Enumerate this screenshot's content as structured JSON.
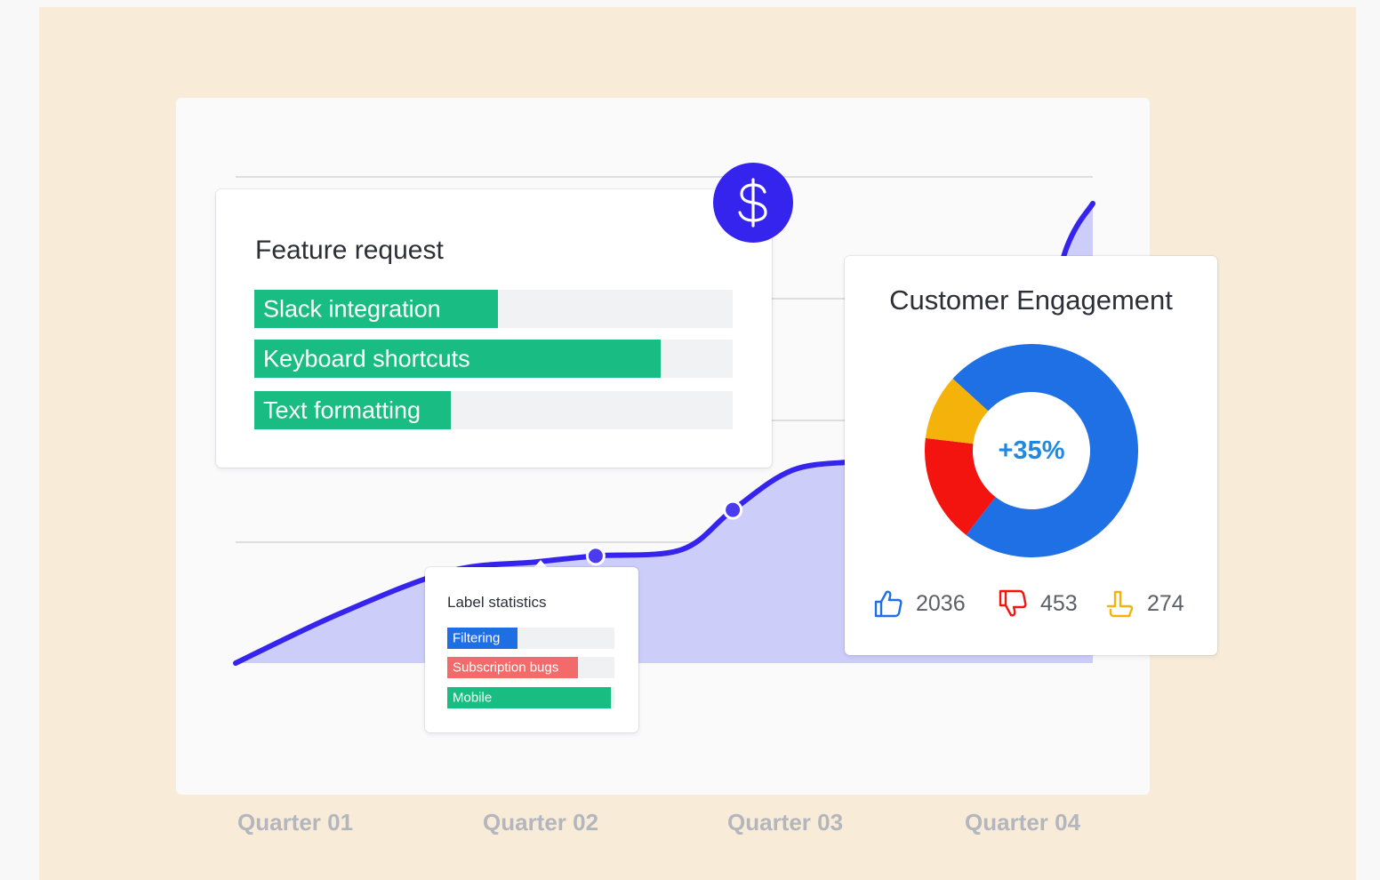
{
  "colors": {
    "background_panel": "#f8ecd9",
    "line": "#3524ee",
    "area": "#cdcdfa",
    "feature_bar": "#19bd84",
    "filtering": "#1e6fe3",
    "subscription_bugs": "#f26a6a",
    "mobile": "#19bd84",
    "donut_blue": "#1f6fe5",
    "donut_red": "#f4140f",
    "donut_yellow": "#f4b20a",
    "center_text": "#1e88e5"
  },
  "chart_data": {
    "type": "area",
    "categories": [
      "Quarter 01",
      "Quarter 02",
      "Quarter 03",
      "Quarter 04"
    ],
    "x": [
      0,
      0.12,
      0.25,
      0.35,
      0.42,
      0.52,
      0.58,
      0.65,
      0.73,
      0.8,
      0.86,
      0.93,
      0.97,
      1.0
    ],
    "y": [
      0,
      16,
      30,
      33,
      35,
      37,
      50,
      63,
      66,
      69,
      72,
      100,
      136,
      150
    ],
    "markers": [
      4,
      6,
      11
    ],
    "ylim": [
      0,
      170
    ],
    "grid": true,
    "gridlines": 4
  },
  "axis": {
    "quarters": [
      "Quarter 01",
      "Quarter 02",
      "Quarter 03",
      "Quarter 04"
    ]
  },
  "feature_request": {
    "title": "Feature request",
    "items": [
      {
        "label": "Slack integration",
        "fill": 0.51
      },
      {
        "label": "Keyboard shortcuts",
        "fill": 0.85
      },
      {
        "label": "Text formatting",
        "fill": 0.41
      }
    ]
  },
  "label_statistics": {
    "title": "Label statistics",
    "items": [
      {
        "label": "Filtering",
        "fill": 0.42,
        "color": "#1e6fe3"
      },
      {
        "label": "Subscription bugs",
        "fill": 0.78,
        "color": "#f26a6a"
      },
      {
        "label": "Mobile",
        "fill": 0.98,
        "color": "#19bd84"
      }
    ]
  },
  "customer_engagement": {
    "title": "Customer Engagement",
    "center": "+35%",
    "segments": [
      {
        "name": "likes",
        "value": 2036,
        "color": "#1f6fe5"
      },
      {
        "name": "dislikes",
        "value": 453,
        "color": "#f4140f"
      },
      {
        "name": "neutral",
        "value": 274,
        "color": "#f4b20a"
      }
    ],
    "stats": [
      {
        "icon": "thumbs-up-icon",
        "value": "2036"
      },
      {
        "icon": "thumbs-down-icon",
        "value": "453"
      },
      {
        "icon": "hand-icon",
        "value": "274"
      }
    ]
  },
  "badge": {
    "icon": "dollar-icon",
    "symbol": "$"
  }
}
